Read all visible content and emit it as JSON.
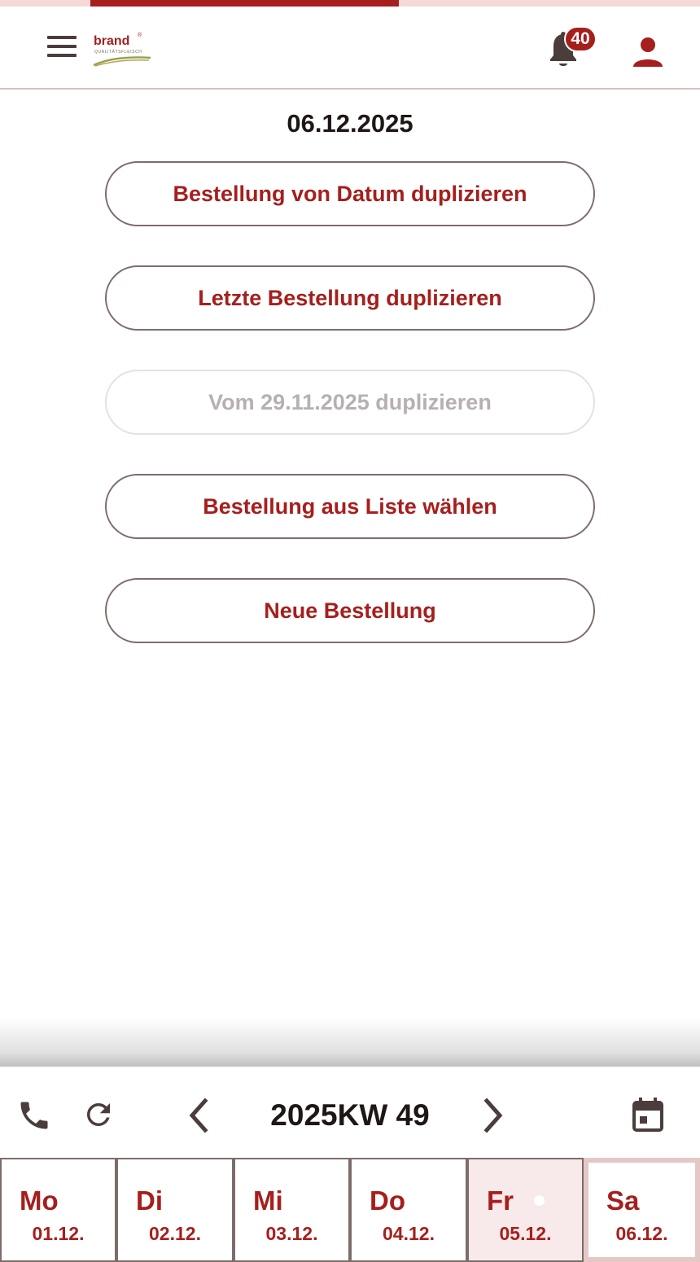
{
  "progress": {
    "fraction": 0.57,
    "track_color": "#f6d9d7",
    "fill_color": "#a51f1d"
  },
  "header": {
    "menu_icon": "hamburger-menu-icon",
    "logo": {
      "word": "brand",
      "reg_mark": "®",
      "subline": "QUALITÄTSFLEISCH"
    },
    "notifications": {
      "icon": "bell-icon",
      "count": "40"
    },
    "user_icon": "person-icon"
  },
  "main": {
    "date": "06.12.2025",
    "actions": [
      {
        "label": "Bestellung von Datum duplizieren",
        "enabled": true
      },
      {
        "label": "Letzte Bestellung duplizieren",
        "enabled": true
      },
      {
        "label": "Vom 29.11.2025 duplizieren",
        "enabled": false
      },
      {
        "label": "Bestellung aus Liste wählen",
        "enabled": true
      },
      {
        "label": "Neue Bestellung",
        "enabled": true
      }
    ]
  },
  "footer": {
    "phone_icon": "phone-icon",
    "refresh_icon": "refresh-icon",
    "prev_icon": "chevron-left-icon",
    "next_icon": "chevron-right-icon",
    "week": "2025KW 49",
    "calendar_icon": "calendar-icon",
    "days": [
      {
        "name": "Mo",
        "date": "01.12."
      },
      {
        "name": "Di",
        "date": "02.12."
      },
      {
        "name": "Mi",
        "date": "03.12."
      },
      {
        "name": "Do",
        "date": "04.12."
      },
      {
        "name": "Fr",
        "date": "05.12."
      },
      {
        "name": "Sa",
        "date": "06.12."
      }
    ]
  },
  "colors": {
    "accent": "#a51f1d",
    "text_dark": "#1e1716",
    "border": "#7d6d6a",
    "disabled_text": "#b6b1b0",
    "disabled_border": "#e6e0df",
    "icon_dark": "#4a3d3b"
  }
}
